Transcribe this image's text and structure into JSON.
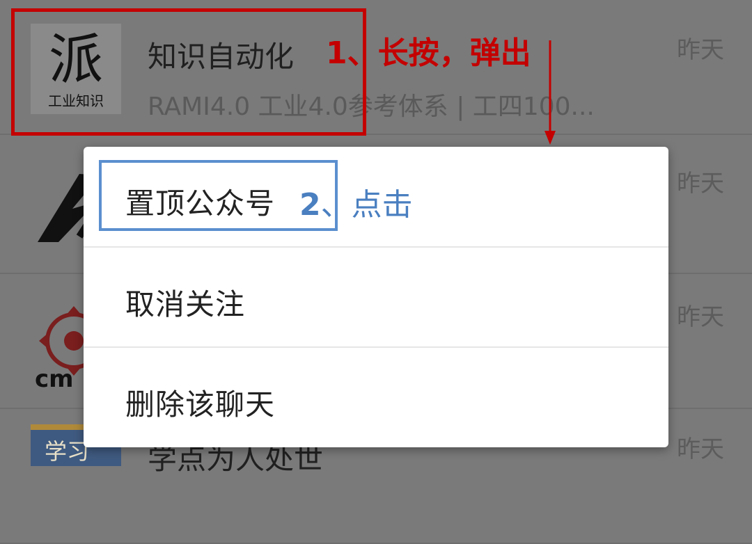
{
  "rows": [
    {
      "title": "知识自动化",
      "snippet": "RAMI4.0 工业4.0参考体系 | 工四100...",
      "time": "昨天",
      "avatar_text_main": "派",
      "avatar_text_sub": "工业知识"
    },
    {
      "title": "",
      "snippet": "",
      "time": "昨天"
    },
    {
      "title": "",
      "snippet": "",
      "time": "昨天",
      "avatar_text": "cm"
    },
    {
      "title": "学点为人处世",
      "snippet": "",
      "time": "昨天",
      "avatar_text": "学习"
    }
  ],
  "menu": {
    "items": [
      {
        "label": "置顶公众号"
      },
      {
        "label": "取消关注"
      },
      {
        "label": "删除该聊天"
      }
    ]
  },
  "annotations": {
    "step1": "1、长按，弹出",
    "step2_num": "2",
    "step2_text": "、点击",
    "red_color": "#c40000",
    "blue_color": "#4a7fc0"
  }
}
